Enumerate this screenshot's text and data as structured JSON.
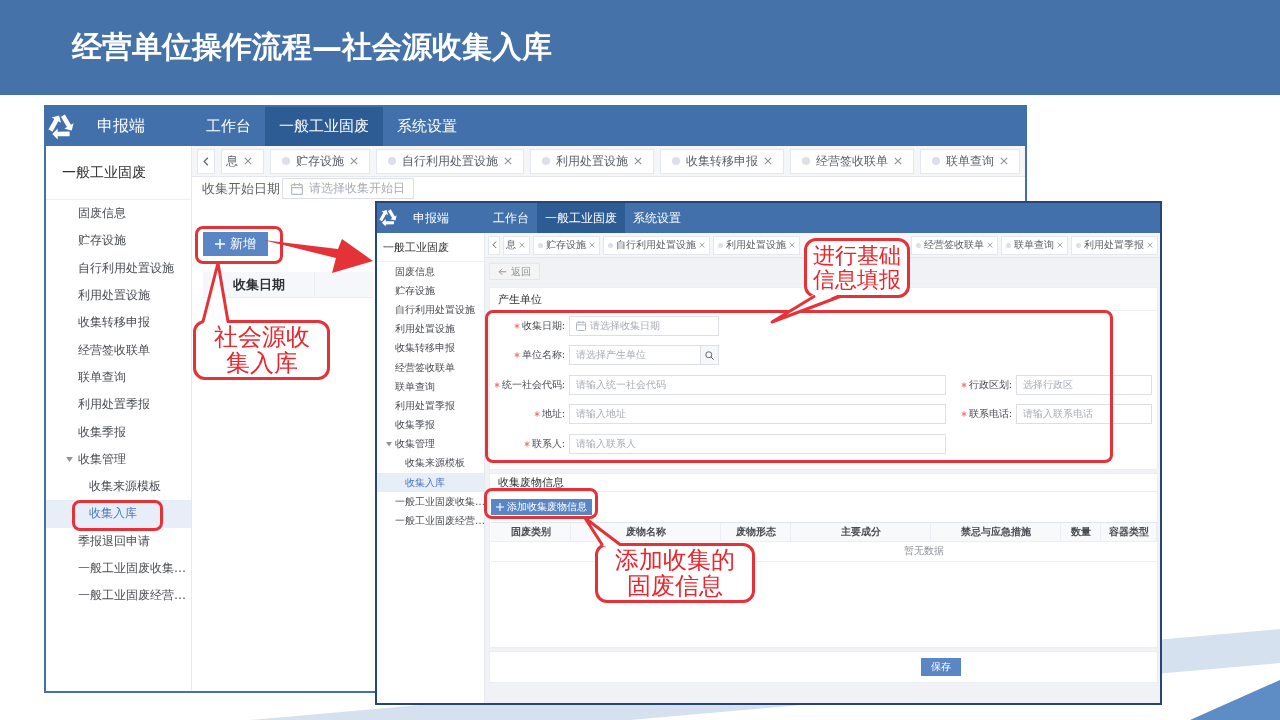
{
  "slide": {
    "title": "经营单位操作流程—社会源收集入库"
  },
  "back_window": {
    "app_name": "申报端",
    "nav": [
      {
        "label": "工作台",
        "selected": false
      },
      {
        "label": "一般工业固废",
        "selected": true
      },
      {
        "label": "系统设置",
        "selected": false
      }
    ],
    "sidebar": {
      "title": "一般工业固废",
      "items": [
        {
          "label": "固废信息",
          "selected": false
        },
        {
          "label": "贮存设施",
          "selected": false
        },
        {
          "label": "自行利用处置设施",
          "selected": false
        },
        {
          "label": "利用处置设施",
          "selected": false
        },
        {
          "label": "收集转移申报",
          "selected": false
        },
        {
          "label": "经营签收联单",
          "selected": false
        },
        {
          "label": "联单查询",
          "selected": false
        },
        {
          "label": "利用处置季报",
          "selected": false
        },
        {
          "label": "收集季报",
          "selected": false
        },
        {
          "label": "收集管理",
          "selected": false,
          "expanded": true,
          "children": [
            {
              "label": "收集来源模板",
              "selected": false
            },
            {
              "label": "收集入库",
              "selected": true
            }
          ]
        },
        {
          "label": "季报退回申请",
          "selected": false
        },
        {
          "label": "一般工业固废收集…",
          "selected": false
        },
        {
          "label": "一般工业固废经营…",
          "selected": false
        }
      ]
    },
    "tabs": [
      {
        "label": "息",
        "kind": "clipped",
        "selected": false
      },
      {
        "label": "贮存设施",
        "kind": "full",
        "selected": false
      },
      {
        "label": "自行利用处置设施",
        "kind": "full",
        "selected": false
      },
      {
        "label": "利用处置设施",
        "kind": "full",
        "selected": false
      },
      {
        "label": "收集转移申报",
        "kind": "full",
        "selected": false
      },
      {
        "label": "经营签收联单",
        "kind": "full",
        "selected": false
      },
      {
        "label": "联单查询",
        "kind": "full",
        "selected": false
      }
    ],
    "filter": {
      "label": "收集开始日期",
      "placeholder": "请选择收集开始日"
    },
    "add_button": "新增",
    "table": {
      "columns": [
        "收集日期"
      ]
    }
  },
  "front_window": {
    "app_name": "申报端",
    "nav": [
      {
        "label": "工作台",
        "selected": false
      },
      {
        "label": "一般工业固废",
        "selected": true
      },
      {
        "label": "系统设置",
        "selected": false
      }
    ],
    "sidebar": {
      "title": "一般工业固废",
      "items": [
        {
          "label": "固废信息",
          "selected": false
        },
        {
          "label": "贮存设施",
          "selected": false
        },
        {
          "label": "自行利用处置设施",
          "selected": false
        },
        {
          "label": "利用处置设施",
          "selected": false
        },
        {
          "label": "收集转移申报",
          "selected": false
        },
        {
          "label": "经营签收联单",
          "selected": false
        },
        {
          "label": "联单查询",
          "selected": false
        },
        {
          "label": "利用处置季报",
          "selected": false
        },
        {
          "label": "收集季报",
          "selected": false
        },
        {
          "label": "收集管理",
          "selected": false,
          "expanded": true,
          "children": [
            {
              "label": "收集来源模板",
              "selected": false
            },
            {
              "label": "收集入库",
              "selected": true
            }
          ]
        },
        {
          "label": "一般工业固废收集…",
          "selected": false
        },
        {
          "label": "一般工业固废经营…",
          "selected": false
        }
      ]
    },
    "tabs": [
      {
        "label": "息",
        "kind": "clipped",
        "selected": false
      },
      {
        "label": "贮存设施",
        "kind": "full",
        "selected": false
      },
      {
        "label": "自行利用处置设施",
        "kind": "full",
        "selected": false
      },
      {
        "label": "利用处置设施",
        "kind": "full",
        "selected": false
      },
      {
        "label": "经营签收联单",
        "kind": "full",
        "selected": false
      },
      {
        "label": "联单查询",
        "kind": "full",
        "selected": false
      },
      {
        "label": "利用处置季报",
        "kind": "full",
        "selected": false
      }
    ],
    "back_button": "返回",
    "producer": {
      "title": "产生单位",
      "rows": [
        [
          {
            "label": "收集日期:",
            "required": true,
            "kind": "date",
            "placeholder": "请选择收集日期"
          }
        ],
        [
          {
            "label": "单位名称:",
            "required": true,
            "kind": "search",
            "placeholder": "请选择产生单位"
          }
        ],
        [
          {
            "label": "统一社会代码:",
            "required": true,
            "kind": "text",
            "placeholder": "请输入统一社会代码"
          },
          {
            "label": "行政区划:",
            "required": true,
            "kind": "text",
            "placeholder": "选择行政区"
          }
        ],
        [
          {
            "label": "地址:",
            "required": true,
            "kind": "text",
            "placeholder": "请输入地址"
          },
          {
            "label": "联系电话:",
            "required": true,
            "kind": "text",
            "placeholder": "请输入联系电话"
          }
        ],
        [
          {
            "label": "联系人:",
            "required": true,
            "kind": "text",
            "placeholder": "请输入联系人"
          }
        ]
      ]
    },
    "waste": {
      "title": "收集废物信息",
      "add_button": "添加收集废物信息",
      "columns": [
        "固废类别",
        "废物名称",
        "废物形态",
        "主要成分",
        "禁忌与应急措施",
        "数量",
        "容器类型"
      ],
      "empty_text": "暂无数据"
    },
    "save_button": "保存"
  },
  "callouts": [
    {
      "text": "社会源收集入库"
    },
    {
      "text": "进行基础信息填报"
    },
    {
      "text": "添加收集的固废信息"
    }
  ]
}
